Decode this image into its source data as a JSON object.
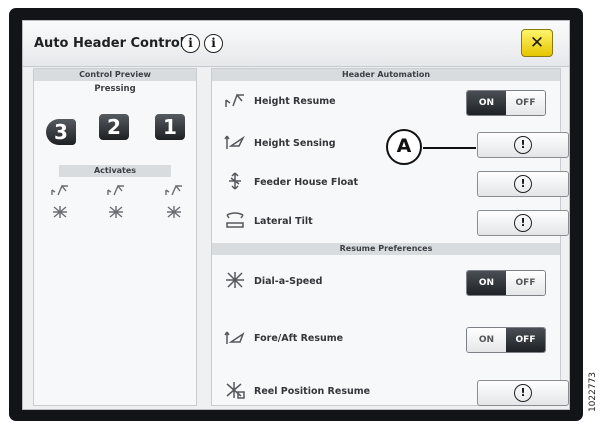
{
  "window": {
    "title": "Auto Header Controls",
    "info_glyph_1": "i",
    "info_glyph_2": "i",
    "close_glyph": "✕"
  },
  "control_preview": {
    "heading": "Control Preview",
    "pressing_label": "Pressing",
    "buttons": [
      "3",
      "2",
      "1"
    ],
    "selected_button": "3",
    "activates_label": "Activates"
  },
  "header_automation": {
    "heading": "Header Automation",
    "rows": [
      {
        "label": "Height Resume",
        "control": "toggle",
        "on_label": "ON",
        "off_label": "OFF",
        "state": "on",
        "icon": "height-resume-icon"
      },
      {
        "label": "Height Sensing",
        "control": "alert",
        "glyph": "!",
        "icon": "height-sensing-icon"
      },
      {
        "label": "Feeder House Float",
        "control": "alert",
        "glyph": "!",
        "icon": "feeder-house-float-icon"
      },
      {
        "label": "Lateral Tilt",
        "control": "alert",
        "glyph": "!",
        "icon": "lateral-tilt-icon"
      }
    ]
  },
  "resume_preferences": {
    "heading": "Resume Preferences",
    "rows": [
      {
        "label": "Dial-a-Speed",
        "control": "toggle",
        "on_label": "ON",
        "off_label": "OFF",
        "state": "on",
        "icon": "dial-a-speed-icon"
      },
      {
        "label": "Fore/Aft Resume",
        "control": "toggle",
        "on_label": "ON",
        "off_label": "OFF",
        "state": "off",
        "icon": "fore-aft-resume-icon"
      },
      {
        "label": "Reel Position Resume",
        "control": "alert",
        "glyph": "!",
        "icon": "reel-position-resume-icon"
      }
    ]
  },
  "callout": {
    "label": "A"
  },
  "reference_number": "1022773",
  "colors": {
    "close_button": "#f5dc10",
    "toggle_active": "#2a2e33",
    "bezel": "#121417"
  }
}
